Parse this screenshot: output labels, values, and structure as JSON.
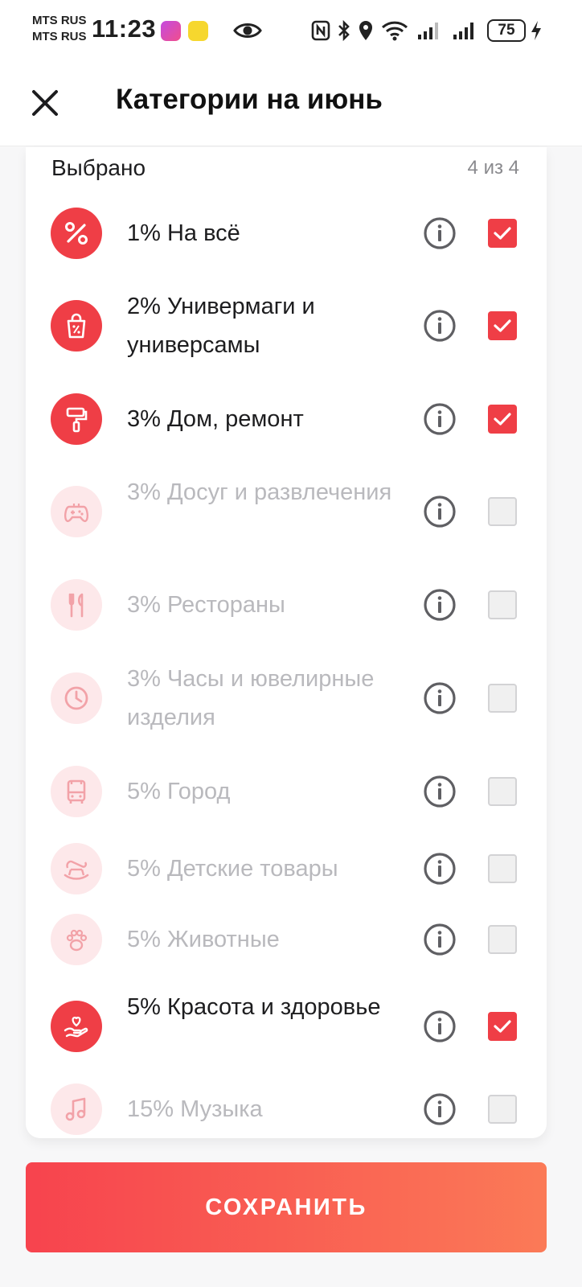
{
  "status_bar": {
    "carrier_1": "MTS RUS",
    "carrier_2": "MTS RUS",
    "time": "11:23",
    "battery": "75",
    "icons": [
      "eye-icon",
      "nfc-icon",
      "bluetooth-icon",
      "location-icon",
      "wifi-icon",
      "signal-icon",
      "signal-icon",
      "battery-icon",
      "charging-icon"
    ]
  },
  "header": {
    "title": "Категории на июнь",
    "close_icon": "close-icon"
  },
  "summary": {
    "label": "Выбрано",
    "count": "4 из 4"
  },
  "categories": [
    {
      "label": "1% На всё",
      "icon": "percent-icon",
      "checked": true
    },
    {
      "label": "2% Универмаги и универсамы",
      "icon": "shopping-bag-icon",
      "checked": true
    },
    {
      "label": "3% Дом, ремонт",
      "icon": "paint-roller-icon",
      "checked": true
    },
    {
      "label": "3% Досуг и развлечения",
      "icon": "gamepad-icon",
      "checked": false
    },
    {
      "label": "3% Рестораны",
      "icon": "fork-knife-icon",
      "checked": false
    },
    {
      "label": "3% Часы и ювелирные изделия",
      "icon": "clock-icon",
      "checked": false
    },
    {
      "label": "5% Город",
      "icon": "bus-icon",
      "checked": false
    },
    {
      "label": "5% Детские товары",
      "icon": "rocking-horse-icon",
      "checked": false
    },
    {
      "label": "5% Животные",
      "icon": "paw-icon",
      "checked": false
    },
    {
      "label": "5% Красота и здоровье",
      "icon": "heart-hand-icon",
      "checked": true
    },
    {
      "label": "15% Музыка",
      "icon": "music-note-icon",
      "checked": false
    }
  ],
  "save_button": {
    "label": "СОХРАНИТЬ"
  },
  "colors": {
    "accent": "#ef3e46",
    "accent_light": "#fde8ea",
    "button_end": "#fb7a57",
    "muted_text": "#b9b9bd"
  }
}
